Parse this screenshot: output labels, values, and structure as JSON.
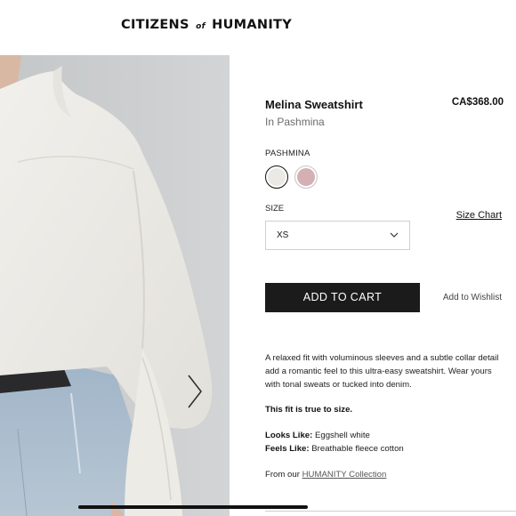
{
  "brand": {
    "left": "CITIZENS",
    "middle": "of",
    "right": "HUMANITY"
  },
  "product": {
    "name": "Melina Sweatshirt",
    "color_line": "In Pashmina",
    "price": "CA$368.00"
  },
  "color": {
    "label": "PASHMINA",
    "swatches": [
      {
        "name": "Pashmina",
        "hex": "#ebe9e4",
        "selected": true
      },
      {
        "name": "Pink",
        "hex": "#d4b0b5",
        "selected": false
      }
    ]
  },
  "size": {
    "label": "SIZE",
    "selected": "XS",
    "chart_link": "Size Chart"
  },
  "actions": {
    "add_to_cart": "ADD TO CART",
    "wishlist": "Add to Wishlist"
  },
  "description": {
    "text": "A relaxed fit with voluminous sleeves and a subtle collar detail add a romantic feel to this ultra-easy sweatshirt. Wear yours with tonal sweats or tucked into denim.",
    "fit_note": "This fit is true to size.",
    "looks_like_label": "Looks Like:",
    "looks_like_value": "Eggshell white",
    "feels_like_label": "Feels Like:",
    "feels_like_value": "Breathable fleece cotton",
    "from_prefix": "From our",
    "collection_link": "HUMANITY Collection"
  },
  "icons": {
    "next": "chevron-right-icon",
    "dropdown": "chevron-down-icon"
  }
}
